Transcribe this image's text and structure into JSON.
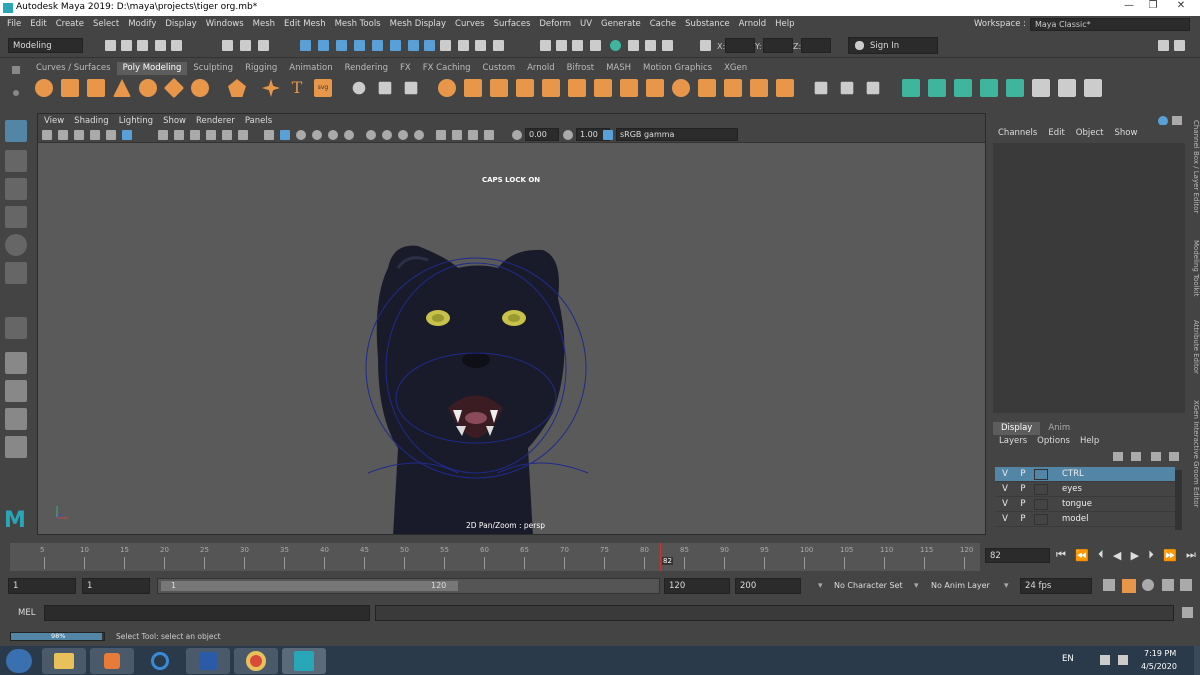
{
  "window": {
    "title": "Autodesk Maya 2019: D:\\maya\\projects\\tiger org.mb*",
    "controls": [
      "—",
      "❐",
      "✕"
    ]
  },
  "menubar": {
    "items": [
      "File",
      "Edit",
      "Create",
      "Select",
      "Modify",
      "Display",
      "Windows",
      "Mesh",
      "Edit Mesh",
      "Mesh Tools",
      "Mesh Display",
      "Curves",
      "Surfaces",
      "Deform",
      "UV",
      "Generate",
      "Cache",
      "Substance",
      "Arnold",
      "Help"
    ],
    "workspace_label": "Workspace :",
    "workspace_value": "Maya Classic*"
  },
  "statusline": {
    "menuset": "Modeling",
    "x_label": "X:",
    "y_label": "Y:",
    "z_label": "Z:",
    "signin": "Sign In"
  },
  "shelf": {
    "tabs": [
      "Curves / Surfaces",
      "Poly Modeling",
      "Sculpting",
      "Rigging",
      "Animation",
      "Rendering",
      "FX",
      "FX Caching",
      "Custom",
      "Arnold",
      "Bifrost",
      "MASH",
      "Motion Graphics",
      "XGen"
    ],
    "active_tab": "Poly Modeling"
  },
  "viewport": {
    "menu": [
      "View",
      "Shading",
      "Lighting",
      "Show",
      "Renderer",
      "Panels"
    ],
    "exposure": "0.00",
    "gamma": "1.00",
    "colorspace": "sRGB gamma",
    "capslock": "CAPS LOCK ON",
    "camera_label": "2D Pan/Zoom : persp"
  },
  "channelbox": {
    "menu": [
      "Channels",
      "Edit",
      "Object",
      "Show"
    ]
  },
  "sidetabs": [
    "Channel Box / Layer Editor",
    "Modeling Toolkit",
    "Attribute Editor",
    "XGen Interactive Groom Editor"
  ],
  "layer_editor": {
    "tabs": [
      "Display",
      "Anim"
    ],
    "active_tab": "Display",
    "menu": [
      "Layers",
      "Options",
      "Help"
    ],
    "layers": [
      {
        "v": "V",
        "p": "P",
        "name": "CTRL",
        "selected": true
      },
      {
        "v": "V",
        "p": "P",
        "name": "eyes",
        "selected": false
      },
      {
        "v": "V",
        "p": "P",
        "name": "tongue",
        "selected": false
      },
      {
        "v": "V",
        "p": "P",
        "name": "model",
        "selected": false
      }
    ]
  },
  "timeslider": {
    "labels": [
      "5",
      "10",
      "15",
      "20",
      "25",
      "30",
      "35",
      "40",
      "45",
      "50",
      "55",
      "60",
      "65",
      "70",
      "75",
      "80",
      "85",
      "90",
      "95",
      "100",
      "105",
      "110",
      "115",
      "120"
    ],
    "current_frame": "82",
    "current_frame_field": "82"
  },
  "range": {
    "start": "1",
    "playback_start": "1",
    "slider_start": "1",
    "slider_end": "120",
    "playback_end": "120",
    "end": "200",
    "character_set": "No Character Set",
    "anim_layer": "No Anim Layer",
    "fps": "24 fps"
  },
  "commandline": {
    "label": "MEL"
  },
  "helpline": {
    "progress": "98%",
    "progress_fraction": 0.98,
    "message": "Select Tool: select an object"
  },
  "taskbar": {
    "language": "EN",
    "time": "7:19 PM",
    "date": "4/5/2020"
  },
  "colors": {
    "accent_orange": "#e8974a",
    "accent_teal": "#3fb59e",
    "layer_select": "#5285a6",
    "maya_teal": "#29a6b8"
  }
}
